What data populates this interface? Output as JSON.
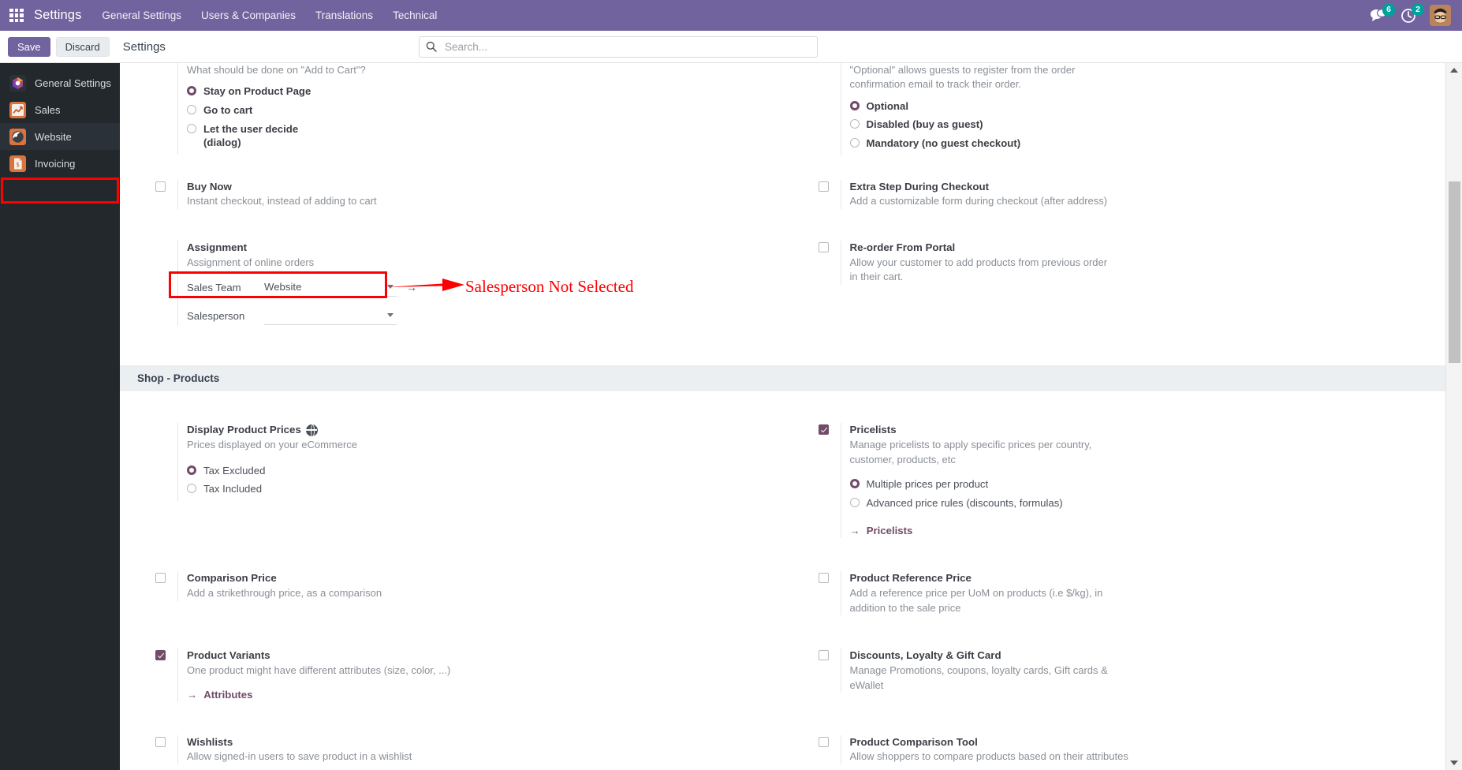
{
  "navbar": {
    "apps_icon": "apps-grid-icon",
    "brand": "Settings",
    "menu": [
      {
        "label": "General Settings"
      },
      {
        "label": "Users & Companies"
      },
      {
        "label": "Translations"
      },
      {
        "label": "Technical"
      }
    ],
    "messages_icon": "chat-bubble-icon",
    "messages_count": "6",
    "activities_icon": "clock-icon",
    "activities_count": "2",
    "avatar_icon": "user-avatar"
  },
  "control_panel": {
    "save_label": "Save",
    "discard_label": "Discard",
    "title": "Settings",
    "search_icon": "search-icon",
    "search_placeholder": "Search...",
    "search_value": ""
  },
  "sidebar": {
    "items": [
      {
        "label": "General Settings",
        "icon": "settings-app-icon",
        "active": false
      },
      {
        "label": "Sales",
        "icon": "sales-chart-icon",
        "active": false
      },
      {
        "label": "Website",
        "icon": "website-globe-icon",
        "active": true
      },
      {
        "label": "Invoicing",
        "icon": "invoice-document-icon",
        "active": false
      }
    ]
  },
  "annotation": {
    "text": "Salesperson Not Selected",
    "color": "#ff0000",
    "arrow_icon": "right-arrow-annotation"
  },
  "main": {
    "add_to_cart": {
      "question": "What should be done on \"Add to Cart\"?",
      "options": [
        {
          "label": "Stay on Product Page",
          "selected": true
        },
        {
          "label": "Go to cart",
          "selected": false
        },
        {
          "label": "Let the user decide\n(dialog)",
          "selected": false
        }
      ]
    },
    "optional_guest": {
      "description": "\"Optional\" allows guests to register from the order confirmation email to track their order.",
      "options": [
        {
          "label": "Optional",
          "selected": true
        },
        {
          "label": "Disabled (buy as guest)",
          "selected": false
        },
        {
          "label": "Mandatory (no guest checkout)",
          "selected": false
        }
      ]
    },
    "buy_now": {
      "title": "Buy Now",
      "desc": "Instant checkout, instead of adding to cart",
      "checked": false
    },
    "extra_step": {
      "title": "Extra Step During Checkout",
      "desc": "Add a customizable form during checkout (after address)",
      "checked": false
    },
    "assignment": {
      "title": "Assignment",
      "desc": "Assignment of online orders",
      "sales_team_label": "Sales Team",
      "sales_team_value": "Website",
      "sales_team_internal_link_icon": "internal-link-arrow-icon",
      "salesperson_label": "Salesperson",
      "salesperson_value": "",
      "dropdown_icon": "chevron-down-icon"
    },
    "reorder_portal": {
      "title": "Re-order From Portal",
      "desc": "Allow your customer to add products from previous order in their cart.",
      "checked": false
    },
    "shop_products_header": "Shop - Products",
    "display_product_prices": {
      "title": "Display Product Prices",
      "icon": "globe-icon",
      "desc": "Prices displayed on your eCommerce",
      "options": [
        {
          "label": "Tax Excluded",
          "selected": true
        },
        {
          "label": "Tax Included",
          "selected": false
        }
      ]
    },
    "pricelists": {
      "title": "Pricelists",
      "desc": "Manage pricelists to apply specific prices per country, customer, products, etc",
      "checked": true,
      "options": [
        {
          "label": "Multiple prices per product",
          "selected": true
        },
        {
          "label": "Advanced price rules (discounts, formulas)",
          "selected": false
        }
      ],
      "link_label": "Pricelists",
      "link_icon": "arrow-right-icon"
    },
    "comparison_price": {
      "title": "Comparison Price",
      "desc": "Add a strikethrough price, as a comparison",
      "checked": false
    },
    "product_reference_price": {
      "title": "Product Reference Price",
      "desc": "Add a reference price per UoM on products (i.e $/kg), in addition to the sale price",
      "checked": false
    },
    "product_variants": {
      "title": "Product Variants",
      "desc": "One product might have different attributes (size, color, ...)",
      "checked": true,
      "link_label": "Attributes",
      "link_icon": "arrow-right-icon"
    },
    "discounts_loyalty": {
      "title": "Discounts, Loyalty & Gift Card",
      "desc": "Manage Promotions, coupons, loyalty cards, Gift cards & eWallet",
      "checked": false
    },
    "wishlists": {
      "title": "Wishlists",
      "desc": "Allow signed-in users to save product in a wishlist",
      "checked": false
    },
    "product_comparison": {
      "title": "Product Comparison Tool",
      "desc": "Allow shoppers to compare products based on their attributes",
      "checked": false
    }
  },
  "scrollbar": {
    "up_icon": "scroll-up-arrow-icon",
    "down_icon": "scroll-down-arrow-icon"
  }
}
